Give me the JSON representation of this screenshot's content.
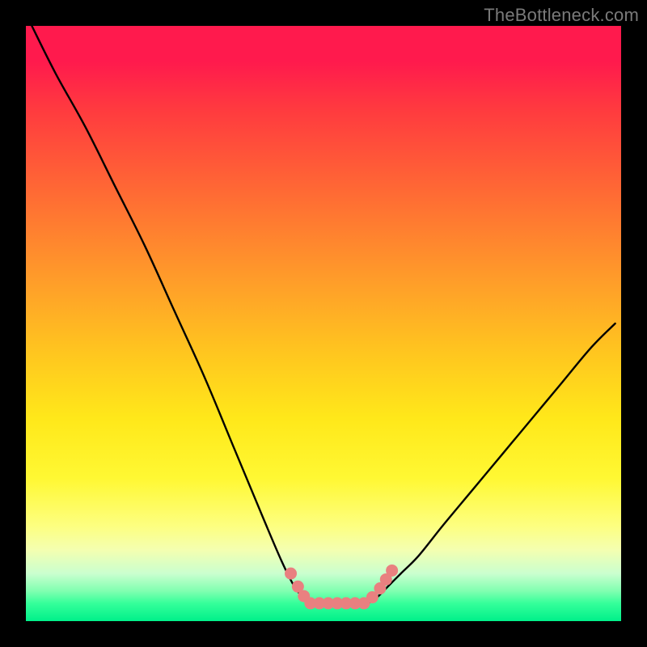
{
  "watermark": {
    "text": "TheBottleneck.com"
  },
  "colors": {
    "curve_stroke": "#000000",
    "marker_fill": "#e98080",
    "marker_stroke": "#d06868"
  },
  "chart_data": {
    "type": "line",
    "title": "",
    "xlabel": "",
    "ylabel": "",
    "xlim": [
      0,
      100
    ],
    "ylim": [
      0,
      100
    ],
    "grid": false,
    "legend": false,
    "series": [
      {
        "name": "left-curve",
        "x": [
          1,
          5,
          10,
          15,
          20,
          25,
          30,
          35,
          40,
          43,
          45,
          46.5,
          47.5
        ],
        "y": [
          100,
          92,
          83,
          73,
          63,
          52,
          41,
          29,
          17,
          10,
          6,
          4,
          3
        ]
      },
      {
        "name": "right-curve",
        "x": [
          57.5,
          59,
          61,
          63,
          66,
          70,
          75,
          80,
          85,
          90,
          95,
          99
        ],
        "y": [
          3,
          4,
          6,
          8,
          11,
          16,
          22,
          28,
          34,
          40,
          46,
          50
        ]
      },
      {
        "name": "floor",
        "x": [
          47.5,
          50,
          52.5,
          55,
          57.5
        ],
        "y": [
          3,
          3,
          3,
          3,
          3
        ]
      }
    ],
    "markers": [
      {
        "x": 44.5,
        "y": 8.0
      },
      {
        "x": 45.7,
        "y": 5.8
      },
      {
        "x": 46.7,
        "y": 4.2
      },
      {
        "x": 47.8,
        "y": 3.0
      },
      {
        "x": 49.3,
        "y": 3.0
      },
      {
        "x": 50.8,
        "y": 3.0
      },
      {
        "x": 52.3,
        "y": 3.0
      },
      {
        "x": 53.8,
        "y": 3.0
      },
      {
        "x": 55.3,
        "y": 3.0
      },
      {
        "x": 56.8,
        "y": 3.0
      },
      {
        "x": 58.2,
        "y": 4.0
      },
      {
        "x": 59.5,
        "y": 5.5
      },
      {
        "x": 60.5,
        "y": 7.0
      },
      {
        "x": 61.5,
        "y": 8.5
      }
    ]
  }
}
